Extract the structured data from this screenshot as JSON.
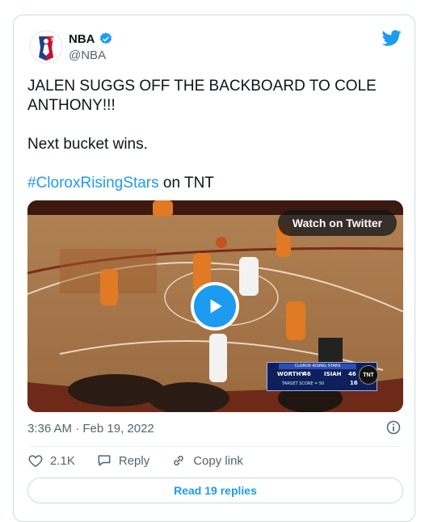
{
  "tweet": {
    "author_name": "NBA",
    "author_handle": "@NBA",
    "paragraphs": [
      "JALEN SUGGS OFF THE BACKBOARD TO COLE ANTHONY!!!",
      "Next bucket wins."
    ],
    "hashtag": "#CloroxRisingStars",
    "hashtag_suffix": " on TNT",
    "timestamp": "3:36 AM · Feb 19, 2022"
  },
  "media": {
    "watch_label": "Watch on Twitter",
    "scorebug": {
      "title": "CLOROX RISING STARS",
      "team1": "WORTHY",
      "score1": "46",
      "team2": "ISIAH",
      "score2": "46",
      "foul_count": "16",
      "target": "TARGET SCORE = 50",
      "network": "TNT"
    }
  },
  "actions": {
    "like_count": "2.1K",
    "reply_label": "Reply",
    "copy_link_label": "Copy link"
  },
  "read_replies_label": "Read 19 replies",
  "colors": {
    "accent": "#1d9bf0",
    "text": "#0f1419",
    "muted": "#536471",
    "border": "#cfd9de"
  }
}
